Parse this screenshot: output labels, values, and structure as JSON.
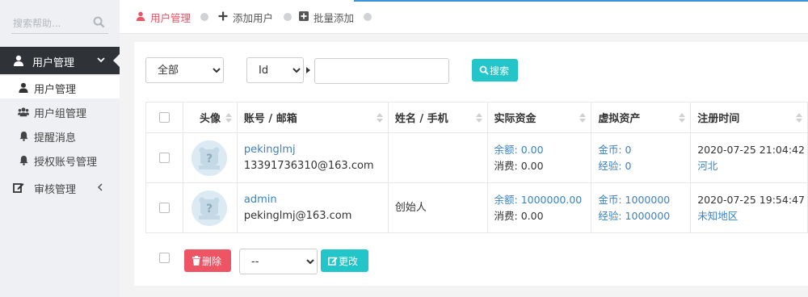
{
  "sidebar": {
    "search_placeholder": "搜索帮助...",
    "user_mgmt": "用户管理",
    "items": [
      {
        "label": "用户管理",
        "icon": "user-icon"
      },
      {
        "label": "用户组管理",
        "icon": "users-icon"
      },
      {
        "label": "提醒消息",
        "icon": "bell-icon"
      },
      {
        "label": "授权账号管理",
        "icon": "bell-icon"
      }
    ],
    "audit_mgmt": "审核管理"
  },
  "tabs": [
    {
      "label": "用户管理",
      "icon": "user-icon",
      "color": "#ed5565"
    },
    {
      "label": "添加用户",
      "icon": "plus-icon",
      "color": "#555555"
    },
    {
      "label": "批量添加",
      "icon": "plus-square-icon",
      "color": "#555555"
    }
  ],
  "filter": {
    "scope_value": "全部",
    "field_value": "Id",
    "keyword": "",
    "search_label": "搜索"
  },
  "table": {
    "headers": [
      "头像",
      "账号 / 邮箱",
      "姓名 / 手机",
      "实际资金",
      "虚拟资产",
      "注册时间"
    ],
    "rows": [
      {
        "account": "pekinglmj",
        "email": "13391736310@163.com",
        "name": "",
        "balance": "余额: 0.00",
        "spent": "消费: 0.00",
        "coins": "金币: 0",
        "exp": "经验: 0",
        "reg_time": "2020-07-25 21:04:42",
        "region": "河北"
      },
      {
        "account": "admin",
        "email": "pekinglmj@163.com",
        "name": "创始人",
        "balance": "余额: 1000000.00",
        "spent": "消费: 0.00",
        "coins": "金币: 1000000",
        "exp": "经验: 1000000",
        "reg_time": "2020-07-25 19:54:47",
        "region": "未知地区"
      }
    ]
  },
  "bulk": {
    "delete_label": "删除",
    "op_value": "--",
    "change_label": "更改"
  },
  "colors": {
    "accent_teal": "#23c6c8",
    "danger": "#ed5565",
    "link": "#3b82c4",
    "sidebar_dark": "#2f3338"
  }
}
